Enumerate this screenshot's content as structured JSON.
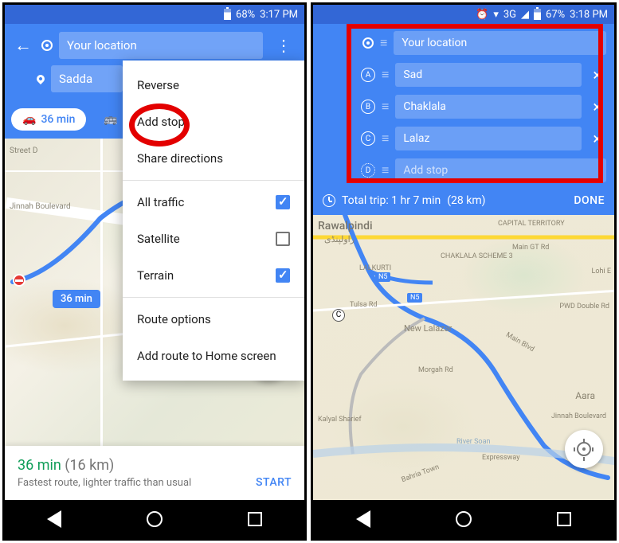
{
  "left": {
    "status": {
      "battery": "68%",
      "time": "3:17 PM"
    },
    "header": {
      "origin": "Your location",
      "dest": "Sadda"
    },
    "modes": {
      "car_time": "36 min"
    },
    "menu": {
      "items": [
        "Reverse",
        "Add stop",
        "Share directions",
        "All traffic",
        "Satellite",
        "Terrain",
        "Route options",
        "Add route to Home screen"
      ],
      "checked": {
        "all_traffic": true,
        "satellite": false,
        "terrain": true
      }
    },
    "map": {
      "labels": {
        "street_d": "Street D",
        "jinnah_blvd": "Jinnah Boulevard"
      },
      "badge": "36 min"
    },
    "card": {
      "time": "36 min",
      "dist": "(16 km)",
      "desc": "Fastest route, lighter traffic than usual",
      "start": "START"
    }
  },
  "right": {
    "status": {
      "network": "3G",
      "battery": "67%",
      "time": "3:18 PM"
    },
    "stops": [
      {
        "letter": "",
        "label": "Your location",
        "removable": false,
        "origin": true
      },
      {
        "letter": "A",
        "label": "Sad",
        "removable": true
      },
      {
        "letter": "B",
        "label": "Chaklala",
        "removable": true
      },
      {
        "letter": "C",
        "label": "Lalaz",
        "removable": true
      },
      {
        "letter": "D",
        "label": "Add stop",
        "removable": false,
        "placeholder": true
      }
    ],
    "trip": {
      "summary": "Total trip: 1 hr 7 min",
      "dist": "(28 km)",
      "done": "DONE"
    },
    "map": {
      "labels": {
        "rawalpindi": "Rawalpindi",
        "valpindi_urdu": "راولپنڈی",
        "lalkurti": "LALKURTI",
        "chaklala": "CHAKLALA SCHEME 3",
        "lohi": "Lohi E",
        "capital": "CAPITAL TERRITORY",
        "tulsa": "Tulsa Rd",
        "lalazar": "New Lalazar",
        "morgah": "Morgah Rd",
        "main_blvd": "Main Blvd",
        "aara": "Aara",
        "kalyal": "Kalyal Sharief",
        "jinnah": "Jinnah Boulevard",
        "bahria": "Bahria Town",
        "expressway": "Expressway",
        "pwd": "PWD Double Rd",
        "gt": "Main GT Rd",
        "river": "River Soan",
        "n5a": "N5",
        "n5b": "N5"
      },
      "markers": {
        "c": "C"
      }
    }
  }
}
